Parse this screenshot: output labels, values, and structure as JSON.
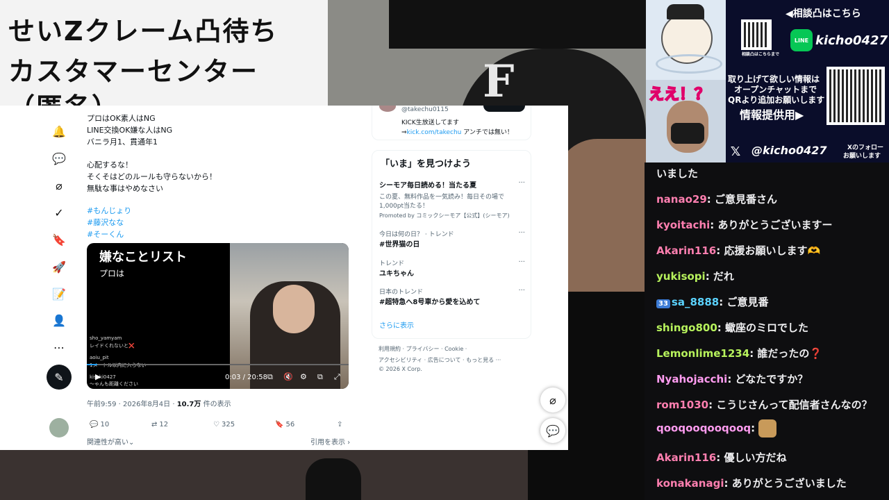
{
  "overlay_title": {
    "line1": "せいZクレーム凸待ち",
    "line2": "カスタマーセンター",
    "line3": "（匿名）"
  },
  "tweet": {
    "lines": [
      "プロはOK素人はNG",
      "LINE交換OK嫌な人はNG",
      "バニラ月1、貫通年1",
      "",
      "心配するな！",
      "そくそはどのルールも守らないから！",
      "無駄な事はやめなさい"
    ],
    "hashtags": [
      "#もんじょり",
      "#藤沢なな",
      "#そーくん"
    ],
    "video": {
      "title": "嫌なことリスト",
      "subtitle": "プロは",
      "chat": [
        "sho_yamyam",
        "レイドくれないと❌",
        "aoiu_pit",
        "1メートル以内に入らない",
        "kisaki0427",
        "〜ゃんも距離ください"
      ],
      "time": "0:03 / 20:58"
    },
    "meta_time": "午前9:59 · 2026年8月4日 · ",
    "meta_views": "10.7万",
    "meta_views_suffix": " 件の表示",
    "actions": {
      "replies": "10",
      "retweets": "12",
      "likes": "325",
      "bookmarks": "56"
    },
    "footer_left": "関連性が高い",
    "footer_right": "引用を表示 ›"
  },
  "sidebar": {
    "profile_handle": "@takechu0115",
    "profile_bio1": "KICK生放送してます",
    "profile_bio2_prefix": "⇒",
    "profile_link": "kick.com/takechu",
    "profile_bio2_suffix": " アンチでは無い！",
    "trends_title": "「いま」を見つけよう",
    "promo": {
      "name": "シーモア毎日読める！当たる夏",
      "desc1": "この夏、無料作品を一気読み！毎日その場で",
      "desc2": "1,000pt当たる！",
      "promoted": "Promoted by コミックシーモア【公式】(シーモア)"
    },
    "trends": [
      {
        "cat": "今日は何の日？ · トレンド",
        "name": "#世界猫の日"
      },
      {
        "cat": "トレンド",
        "name": "ユキちゃん"
      },
      {
        "cat": "日本のトレンド",
        "name": "#超特急へ8号車から愛を込めて"
      }
    ],
    "show_more": "さらに表示",
    "legal1": "利用規約 ·  プライバシー ·  Cookie ·",
    "legal2": "アクセシビリティ ·  広告について ·  もっと見る ···",
    "legal3": "© 2026 X Corp."
  },
  "promo_panel": {
    "consult": "◀相談凸はこちら",
    "line_id": "kicho0427",
    "line_label": "LINE",
    "qr_caption": "相談凸はこちらまで",
    "info1": "取り上げて欲しい情報は",
    "info2": "オープンチャットまで",
    "info3": "QRより追加お願いします",
    "info4": "情報提供用▶",
    "ee": "ええ！？",
    "x_handle": "@kicho0427",
    "x_follow1": "Xのフォロー",
    "x_follow2": "お願いします"
  },
  "chat": [
    {
      "user": "",
      "color": "#efeff1",
      "text": "いました",
      "badge": ""
    },
    {
      "user": "nanao29",
      "color": "#ff7fb0",
      "text": ": ご意見番さん",
      "badge": ""
    },
    {
      "user": "kyoitachi",
      "color": "#ff7fb0",
      "text": ": ありがとうございますー",
      "badge": ""
    },
    {
      "user": "Akarin116",
      "color": "#ff7fb0",
      "text": ": 応援お願いします🫶",
      "badge": ""
    },
    {
      "user": "yukisopi",
      "color": "#b7f25c",
      "text": ": だれ",
      "badge": ""
    },
    {
      "user": "sa_8888",
      "color": "#5bd3ff",
      "text": ": ご意見番",
      "badge": "33"
    },
    {
      "user": "shingo800",
      "color": "#b7f25c",
      "text": ": 蠍座のミロでした",
      "badge": ""
    },
    {
      "user": "Lemonlime1234",
      "color": "#b7f25c",
      "text": ": 誰だったの❓",
      "badge": ""
    },
    {
      "user": "Nyahojacchi",
      "color": "#ff9cf0",
      "text": ": どなたですか？",
      "badge": ""
    },
    {
      "user": "rom1030",
      "color": "#ff7fb0",
      "text": ": こうじさんって配信者さんなの？",
      "badge": ""
    },
    {
      "user": "qooqooqooqooq",
      "color": "#ff9cf0",
      "text": ":",
      "badge": ""
    },
    {
      "user": "Akarin116",
      "color": "#ff7fb0",
      "text": ": 優しい方だね",
      "badge": ""
    },
    {
      "user": "konakanagi",
      "color": "#ff7fb0",
      "text": ": ありがとうございました",
      "badge": ""
    }
  ],
  "colors": {
    "x_blue": "#1d9bf0",
    "chat_bg": "#0e0e10",
    "line_green": "#06c755"
  }
}
